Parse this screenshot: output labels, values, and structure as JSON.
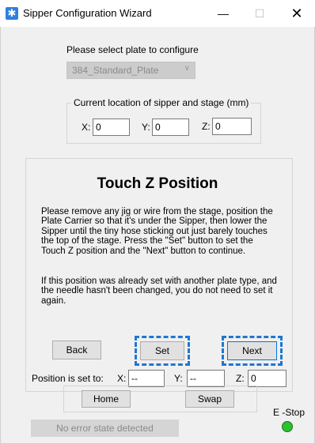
{
  "window": {
    "title": "Sipper Configuration Wizard",
    "minimize_glyph": "—",
    "maximize_glyph": "☐",
    "close_glyph": "✕"
  },
  "plate": {
    "prompt": "Please select plate to configure",
    "selected": "384_Standard_Plate"
  },
  "current_location": {
    "title": "Current location of sipper and stage (mm)",
    "x_label": "X:",
    "x_value": "0",
    "y_label": "Y:",
    "y_value": "0",
    "z_label": "Z:",
    "z_value": "0"
  },
  "touch_z": {
    "heading": "Touch Z Position",
    "instructions": "Please remove any jig or wire from the stage, position the Plate Carrier so that it's under the Sipper, then lower the Sipper until the tiny hose sticking out just barely touches the top of the stage. Press the \"Set\" button to set the Touch Z position and the \"Next\" button to continue.",
    "note": "If this position was already set with another plate type, and the needle hasn't been changed, you do not need to set it again.",
    "back_label": "Back",
    "set_label": "Set",
    "next_label": "Next"
  },
  "position_set": {
    "label": "Position is set to:",
    "x_label": "X:",
    "x_value": "--",
    "y_label": "Y:",
    "y_value": "--",
    "z_label": "Z:",
    "z_value": "0"
  },
  "footer": {
    "home_label": "Home",
    "swap_label": "Swap",
    "estop_label": "E -Stop",
    "estop_color": "#2ec12e",
    "status_text": "No error state detected"
  },
  "colors": {
    "highlight_dash": "#1f77d0"
  }
}
